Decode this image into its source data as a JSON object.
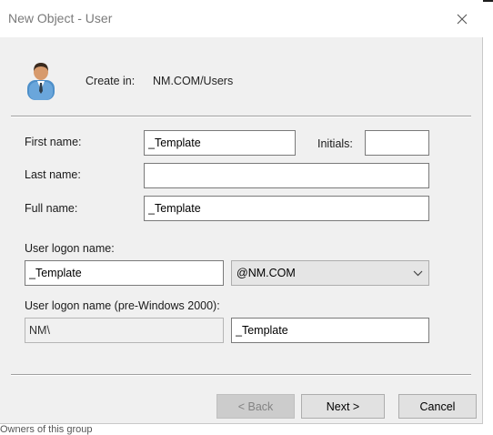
{
  "dialog": {
    "title": "New Object - User",
    "create_in_label": "Create in:",
    "create_in_value": "NM.COM/Users"
  },
  "fields": {
    "first_name": {
      "label": "First name:",
      "value": "_Template"
    },
    "initials": {
      "label": "Initials:",
      "value": ""
    },
    "last_name": {
      "label": "Last name:",
      "value": ""
    },
    "full_name": {
      "label": "Full name:",
      "value": "_Template"
    },
    "logon_name": {
      "label": "User logon name:",
      "value": "_Template",
      "domain": "@NM.COM"
    },
    "pre2000": {
      "label": "User logon name (pre-Windows 2000):",
      "prefix": "NM\\",
      "value": "_Template"
    }
  },
  "buttons": {
    "back": "< Back",
    "next": "Next >",
    "cancel": "Cancel"
  },
  "background": {
    "footer_text": "Owners of this group"
  },
  "icons": {
    "close": "close-icon",
    "user": "user-icon",
    "dropdown": "chevron-down-icon"
  },
  "colors": {
    "dialog_bg": "#f0f0f0",
    "titlebar_bg": "#ffffff",
    "title_text": "#7a7a7a",
    "disabled_text": "#838383"
  }
}
